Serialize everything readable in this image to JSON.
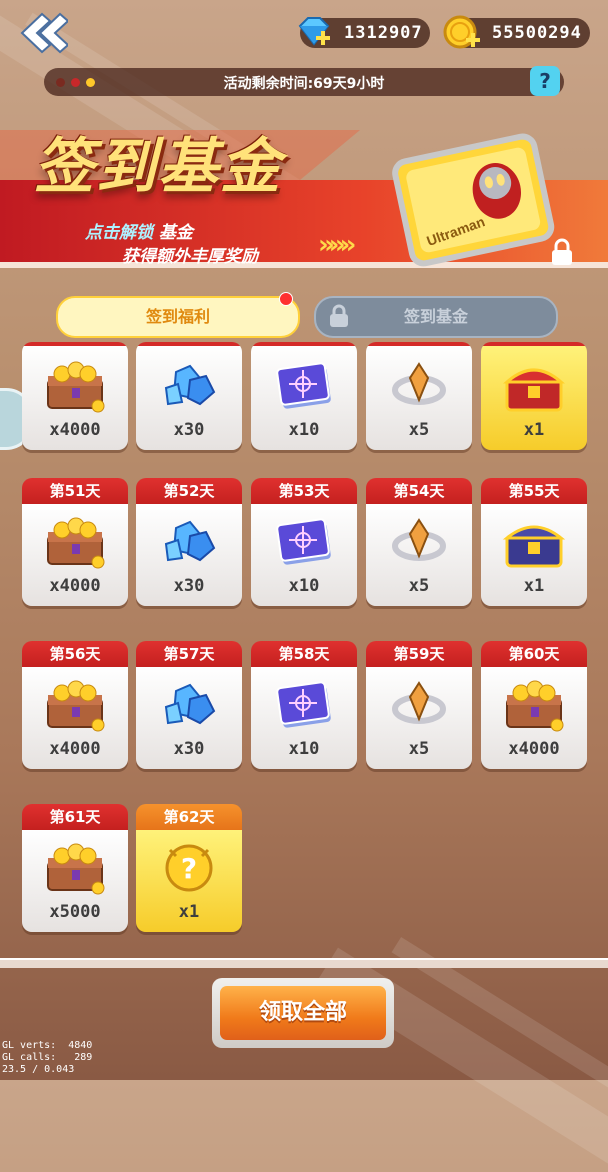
{
  "header": {
    "back_icon": "double-chevron-left-icon",
    "diamonds": "1312907",
    "coins": "55500294",
    "diamond_icon": "diamond-plus-icon",
    "coin_icon": "coin-plus-icon"
  },
  "timer": {
    "text": "活动剩余时间:69天9小时",
    "help": "?"
  },
  "banner": {
    "title": "签到基金",
    "line1_prefix": "点击解锁",
    "line1_highlight": "基金",
    "line2": "获得额外丰厚奖励",
    "arrows": "»»»",
    "card_text": "Ultraman"
  },
  "tabs": {
    "welfare": "签到福利",
    "fund": "签到基金"
  },
  "rows": [
    {
      "items": [
        {
          "day": "",
          "icon": "treasure-chest-coins-icon",
          "qty": "x4000"
        },
        {
          "day": "",
          "icon": "blue-crystals-icon",
          "qty": "x30"
        },
        {
          "day": "",
          "icon": "purple-card-icon",
          "qty": "x10"
        },
        {
          "day": "",
          "icon": "crystal-ring-icon",
          "qty": "x5"
        },
        {
          "day": "",
          "icon": "red-treasure-chest-icon",
          "qty": "x1",
          "gold": true
        }
      ]
    },
    {
      "items": [
        {
          "day": "第51天",
          "icon": "treasure-chest-coins-icon",
          "qty": "x4000"
        },
        {
          "day": "第52天",
          "icon": "blue-crystals-icon",
          "qty": "x30"
        },
        {
          "day": "第53天",
          "icon": "purple-card-icon",
          "qty": "x10"
        },
        {
          "day": "第54天",
          "icon": "crystal-ring-icon",
          "qty": "x5"
        },
        {
          "day": "第55天",
          "icon": "blue-treasure-chest-icon",
          "qty": "x1"
        }
      ]
    },
    {
      "items": [
        {
          "day": "第56天",
          "icon": "treasure-chest-coins-icon",
          "qty": "x4000"
        },
        {
          "day": "第57天",
          "icon": "blue-crystals-icon",
          "qty": "x30"
        },
        {
          "day": "第58天",
          "icon": "purple-card-icon",
          "qty": "x10"
        },
        {
          "day": "第59天",
          "icon": "crystal-ring-icon",
          "qty": "x5"
        },
        {
          "day": "第60天",
          "icon": "treasure-chest-coins-icon",
          "qty": "x4000"
        }
      ]
    },
    {
      "items": [
        {
          "day": "第61天",
          "icon": "treasure-chest-coins-icon",
          "qty": "x5000"
        },
        {
          "day": "第62天",
          "icon": "mystery-orb-icon",
          "qty": "x1",
          "gold": true
        }
      ]
    }
  ],
  "claim_button": "领取全部",
  "debug": {
    "line1": "GL verts:  4840",
    "line2": "GL calls:   289",
    "line3": "23.5 / 0.043"
  },
  "colors": {
    "accent_red": "#d42a28",
    "accent_gold": "#f6cc2a",
    "tab_active": "#fff6c0",
    "tab_locked": "#7e8c9c",
    "claim_orange": "#f07a1a"
  }
}
